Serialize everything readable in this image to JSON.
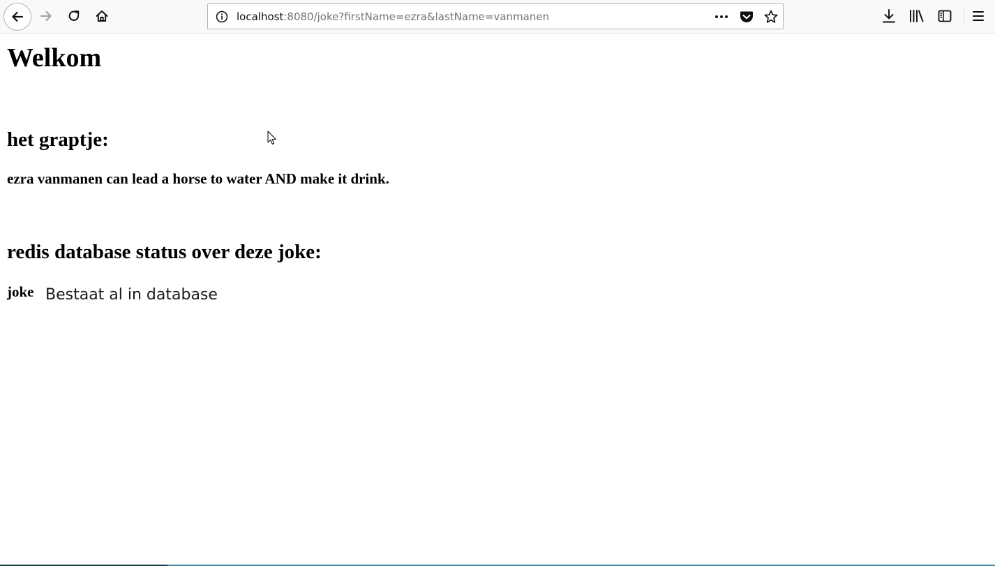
{
  "browser": {
    "url_host": "localhost",
    "url_rest": ":8080/joke?firstName=ezra&lastName=vanmanen",
    "icons": {
      "back": "back-arrow-icon",
      "forward": "forward-arrow-icon",
      "reload": "reload-icon",
      "home": "home-icon",
      "site_info": "info-icon",
      "page_actions": "more-dots-icon",
      "pocket": "pocket-icon",
      "bookmark": "star-icon",
      "downloads": "download-icon",
      "library": "library-icon",
      "sidebar": "sidebar-icon",
      "menu": "hamburger-menu-icon"
    }
  },
  "page": {
    "title": "Welkom",
    "joke_heading": "het graptje:",
    "joke_text": "ezra vanmanen can lead a horse to water AND make it drink.",
    "status_heading": "redis database status over deze joke:",
    "status_label": "joke",
    "status_value": "Bestaat al in database"
  },
  "colors": {
    "toolbar_bg": "#f9f9fa",
    "url_muted": "#737373",
    "icon": "#0c0c0d",
    "forward_disabled": "#a0a0a2",
    "taskbar_accent": "#3c8a9e"
  }
}
